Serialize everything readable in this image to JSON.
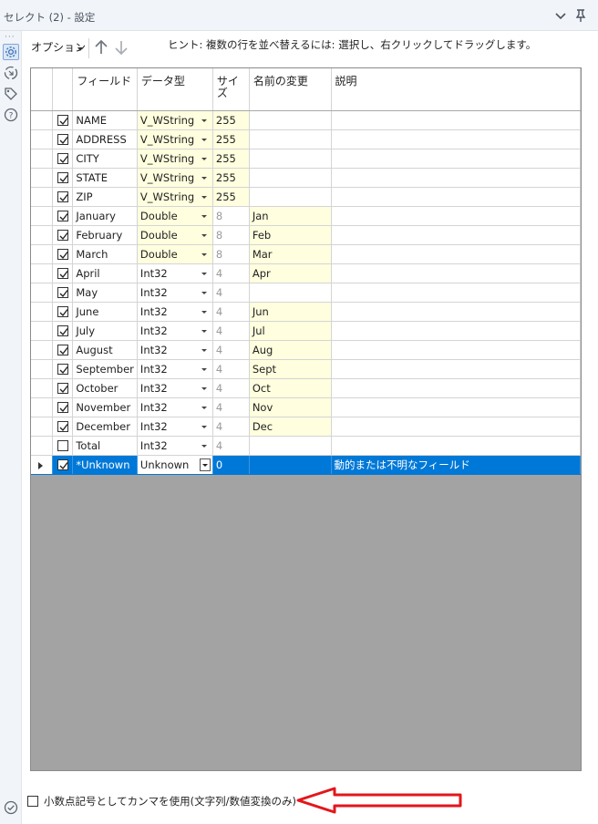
{
  "window": {
    "title": "セレクト (2) - 設定"
  },
  "toolbar": {
    "options_label": "オプション"
  },
  "hint": "ヒント: 複数の行を並べ替えるには: 選択し、右クリックしてドラッグします。",
  "grid": {
    "columns": [
      "フィールド",
      "データ型",
      "サイズ",
      "名前の変更",
      "説明"
    ],
    "rows": [
      {
        "checked": true,
        "field": "NAME",
        "type": "V_WString",
        "size": "255",
        "rename": "",
        "desc": ""
      },
      {
        "checked": true,
        "field": "ADDRESS",
        "type": "V_WString",
        "size": "255",
        "rename": "",
        "desc": ""
      },
      {
        "checked": true,
        "field": "CITY",
        "type": "V_WString",
        "size": "255",
        "rename": "",
        "desc": ""
      },
      {
        "checked": true,
        "field": "STATE",
        "type": "V_WString",
        "size": "255",
        "rename": "",
        "desc": ""
      },
      {
        "checked": true,
        "field": "ZIP",
        "type": "V_WString",
        "size": "255",
        "rename": "",
        "desc": ""
      },
      {
        "checked": true,
        "field": "January",
        "type": "Double",
        "size": "8",
        "rename": "Jan",
        "desc": ""
      },
      {
        "checked": true,
        "field": "February",
        "type": "Double",
        "size": "8",
        "rename": "Feb",
        "desc": ""
      },
      {
        "checked": true,
        "field": "March",
        "type": "Double",
        "size": "8",
        "rename": "Mar",
        "desc": ""
      },
      {
        "checked": true,
        "field": "April",
        "type": "Int32",
        "size": "4",
        "rename": "Apr",
        "desc": ""
      },
      {
        "checked": true,
        "field": "May",
        "type": "Int32",
        "size": "4",
        "rename": "",
        "desc": ""
      },
      {
        "checked": true,
        "field": "June",
        "type": "Int32",
        "size": "4",
        "rename": "Jun",
        "desc": ""
      },
      {
        "checked": true,
        "field": "July",
        "type": "Int32",
        "size": "4",
        "rename": "Jul",
        "desc": ""
      },
      {
        "checked": true,
        "field": "August",
        "type": "Int32",
        "size": "4",
        "rename": "Aug",
        "desc": ""
      },
      {
        "checked": true,
        "field": "September",
        "type": "Int32",
        "size": "4",
        "rename": "Sept",
        "desc": ""
      },
      {
        "checked": true,
        "field": "October",
        "type": "Int32",
        "size": "4",
        "rename": "Oct",
        "desc": ""
      },
      {
        "checked": true,
        "field": "November",
        "type": "Int32",
        "size": "4",
        "rename": "Nov",
        "desc": ""
      },
      {
        "checked": true,
        "field": "December",
        "type": "Int32",
        "size": "4",
        "rename": "Dec",
        "desc": ""
      },
      {
        "checked": false,
        "field": "Total",
        "type": "Int32",
        "size": "4",
        "rename": "",
        "desc": ""
      },
      {
        "checked": true,
        "field": "*Unknown",
        "type": "Unknown",
        "size": "0",
        "rename": "",
        "desc": "動的または不明なフィールド",
        "selected": true
      }
    ]
  },
  "footer": {
    "comma_label": "小数点記号としてカンマを使用(文字列/数値変換のみ)",
    "comma_checked": false
  },
  "colors": {
    "selection": "#0078d7",
    "highlight_cell": "#ffffdf",
    "grid_empty": "#a3a3a3",
    "annotation_arrow": "#e3161b"
  },
  "icons": [
    "chevron-down-icon",
    "pin-icon",
    "gear-icon",
    "connection-icon",
    "tag-icon",
    "help-icon",
    "arrow-up-icon",
    "arrow-down-icon",
    "check-circle-icon",
    "red-arrow-annotation"
  ]
}
